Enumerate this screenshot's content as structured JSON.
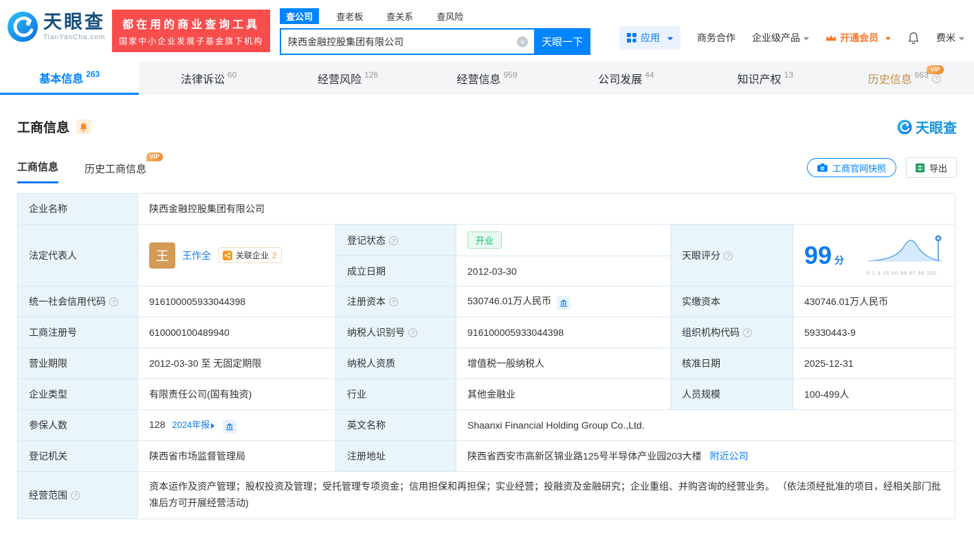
{
  "header": {
    "logo": {
      "brand": "天眼查",
      "domain": "TianYanCha.com"
    },
    "promo": {
      "line1": "都在用的商业查询工具",
      "line2": "国家中小企业发展子基金旗下机构"
    },
    "search": {
      "tabs": [
        {
          "label": "查公司"
        },
        {
          "label": "查老板"
        },
        {
          "label": "查关系"
        },
        {
          "label": "查风险"
        }
      ],
      "value": "陕西金融控股集团有限公司",
      "button": "天眼一下"
    },
    "nav": {
      "apps": "应用",
      "cooperation": "商务合作",
      "enterprise": "企业级产品",
      "vip": "开通会员",
      "user": "费米"
    }
  },
  "tabbar": [
    {
      "label": "基本信息",
      "count": "263"
    },
    {
      "label": "法律诉讼",
      "count": "60"
    },
    {
      "label": "经营风险",
      "count": "126"
    },
    {
      "label": "经营信息",
      "count": "959"
    },
    {
      "label": "公司发展",
      "count": "44"
    },
    {
      "label": "知识产权",
      "count": "13"
    },
    {
      "label": "历史信息",
      "count": "663",
      "badge": "VIP"
    }
  ],
  "section": {
    "title": "工商信息",
    "subtab_current": "工商信息",
    "subtab_history": "历史工商信息",
    "vip": "VIP",
    "snapshot": "工商官网快照",
    "export": "导出",
    "watermark": "天眼查"
  },
  "info": {
    "company_name_label": "企业名称",
    "company_name": "陕西金融控股集团有限公司",
    "legal_label": "法定代表人",
    "legal_avatar": "王",
    "legal_name": "王作全",
    "related_label": "关联企业",
    "related_count": "2",
    "status_label": "登记状态",
    "status": "开业",
    "established_label": "成立日期",
    "established": "2012-03-30",
    "score_label": "天眼评分",
    "score": "99",
    "score_unit": "分",
    "score_axis": "0 1 3 15 50 85 97 99 100",
    "rows": [
      [
        {
          "label": "统一社会信用代码",
          "value": "916100005933044398"
        },
        {
          "label": "注册资本",
          "value": "530746.01万人民币"
        },
        {
          "label": "实缴资本",
          "value": "430746.01万人民币"
        }
      ],
      [
        {
          "label": "工商注册号",
          "value": "610000100489940"
        },
        {
          "label": "纳税人识别号",
          "value": "916100005933044398"
        },
        {
          "label": "组织机构代码",
          "value": "59330443-9"
        }
      ],
      [
        {
          "label": "营业期限",
          "value": "2012-03-30 至 无固定期限"
        },
        {
          "label": "纳税人资质",
          "value": "增值税一般纳税人"
        },
        {
          "label": "核准日期",
          "value": "2025-12-31"
        }
      ],
      [
        {
          "label": "企业类型",
          "value": "有限责任公司(国有独资)"
        },
        {
          "label": "行业",
          "value": "其他金融业"
        },
        {
          "label": "人员规模",
          "value": "100-499人"
        }
      ]
    ],
    "insured_label": "参保人数",
    "insured_value": "128",
    "report_link": "2024年报",
    "english_label": "英文名称",
    "english_name": "Shaanxi Financial Holding Group Co.,Ltd.",
    "registry_label": "登记机关",
    "registry": "陕西省市场监督管理局",
    "address_label": "注册地址",
    "address": "陕西省西安市高新区锦业路125号半导体产业园203大楼",
    "nearby": "附近公司",
    "scope_label": "经营范围",
    "scope": "资本运作及资产管理；股权投资及管理；受托管理专项资金；信用担保和再担保；实业经营；投融资及金融研究；企业重组、并购咨询的经营业务。 （依法须经批准的项目，经相关部门批准后方可开展经营活动)"
  }
}
